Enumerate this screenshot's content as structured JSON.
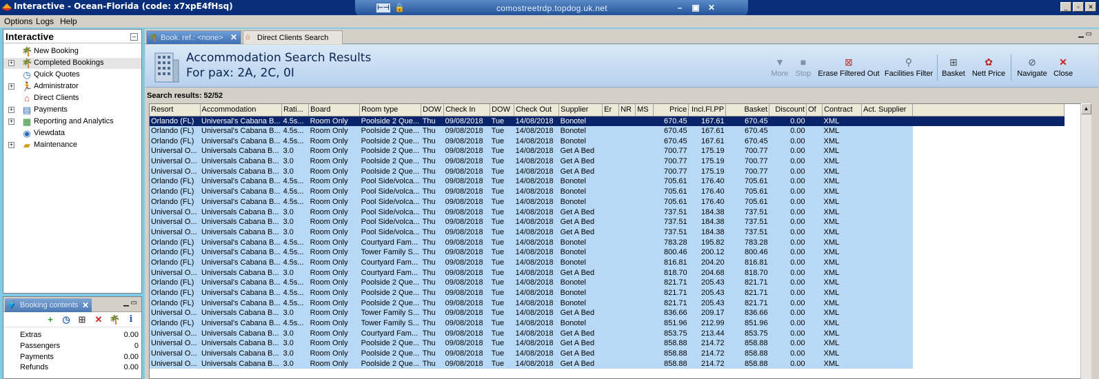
{
  "window": {
    "title": "Interactive - Ocean-Florida (code: x7xpE4fHsq)",
    "rdp_host": "comostreetrdp.topdog.uk.net"
  },
  "menu": [
    "Options",
    "Logs",
    "Help"
  ],
  "nav": {
    "title": "Interactive",
    "items": [
      {
        "label": "New Booking",
        "icon": "palm-tree-icon",
        "expandable": false
      },
      {
        "label": "Completed Bookings",
        "icon": "palm-tree-icon",
        "expandable": true
      },
      {
        "label": "Quick Quotes",
        "icon": "clock-icon",
        "expandable": false
      },
      {
        "label": "Administrator",
        "icon": "user-run-icon",
        "expandable": true
      },
      {
        "label": "Direct Clients",
        "icon": "house-icon",
        "expandable": false
      },
      {
        "label": "Payments",
        "icon": "payment-icon",
        "expandable": true
      },
      {
        "label": "Reporting and Analytics",
        "icon": "report-icon",
        "expandable": true
      },
      {
        "label": "Viewdata",
        "icon": "globe-icon",
        "expandable": false
      },
      {
        "label": "Maintenance",
        "icon": "folder-icon",
        "expandable": true
      }
    ]
  },
  "booking": {
    "tab_label": "Booking contents",
    "rows": [
      {
        "label": "Extras",
        "value": "0.00"
      },
      {
        "label": "Passengers",
        "value": "0"
      },
      {
        "label": "Payments",
        "value": "0.00"
      },
      {
        "label": "Refunds",
        "value": "0.00"
      }
    ]
  },
  "tabs": {
    "active": "Book. ref.: <none>",
    "second": "Direct Clients Search"
  },
  "header": {
    "title": "Accommodation Search Results",
    "subtitle": "For pax: 2A, 2C, 0I"
  },
  "toolbar": {
    "more": "More",
    "stop": "Stop",
    "erase": "Erase Filtered Out",
    "facilities": "Facilities Filter",
    "basket": "Basket",
    "nett": "Nett Price",
    "navigate": "Navigate",
    "close": "Close"
  },
  "results_label": "Search results: 52/52",
  "columns": [
    "Resort",
    "Accommodation",
    "Rati...",
    "Board",
    "Room type",
    "DOW",
    "Check In",
    "DOW",
    "Check Out",
    "Supplier",
    "Er",
    "NR",
    "MS",
    "Price",
    "Incl.Fl.PP",
    "Basket",
    "Discount",
    "Of",
    "Contract",
    "Act. Supplier"
  ],
  "rows": [
    [
      "Orlando (FL)",
      "Universal's Cabana B...",
      "4.5s...",
      "Room Only",
      "Poolside 2 Que...",
      "Thu",
      "09/08/2018",
      "Tue",
      "14/08/2018",
      "Bonotel",
      "",
      "",
      "",
      "670.45",
      "167.61",
      "670.45",
      "0.00",
      "",
      "XML",
      ""
    ],
    [
      "Orlando (FL)",
      "Universal's Cabana B...",
      "4.5s...",
      "Room Only",
      "Poolside 2 Que...",
      "Thu",
      "09/08/2018",
      "Tue",
      "14/08/2018",
      "Bonotel",
      "",
      "",
      "",
      "670.45",
      "167.61",
      "670.45",
      "0.00",
      "",
      "XML",
      ""
    ],
    [
      "Orlando (FL)",
      "Universal's Cabana B...",
      "4.5s...",
      "Room Only",
      "Poolside 2 Que...",
      "Thu",
      "09/08/2018",
      "Tue",
      "14/08/2018",
      "Bonotel",
      "",
      "",
      "",
      "670.45",
      "167.61",
      "670.45",
      "0.00",
      "",
      "XML",
      ""
    ],
    [
      "Universal O...",
      "Universals Cabana B...",
      "3.0",
      "Room Only",
      "Poolside 2 Que...",
      "Thu",
      "09/08/2018",
      "Tue",
      "14/08/2018",
      "Get A Bed",
      "",
      "",
      "",
      "700.77",
      "175.19",
      "700.77",
      "0.00",
      "",
      "XML",
      ""
    ],
    [
      "Universal O...",
      "Universals Cabana B...",
      "3.0",
      "Room Only",
      "Poolside 2 Que...",
      "Thu",
      "09/08/2018",
      "Tue",
      "14/08/2018",
      "Get A Bed",
      "",
      "",
      "",
      "700.77",
      "175.19",
      "700.77",
      "0.00",
      "",
      "XML",
      ""
    ],
    [
      "Universal O...",
      "Universals Cabana B...",
      "3.0",
      "Room Only",
      "Poolside 2 Que...",
      "Thu",
      "09/08/2018",
      "Tue",
      "14/08/2018",
      "Get A Bed",
      "",
      "",
      "",
      "700.77",
      "175.19",
      "700.77",
      "0.00",
      "",
      "XML",
      ""
    ],
    [
      "Orlando (FL)",
      "Universal's Cabana B...",
      "4.5s...",
      "Room Only",
      "Pool Side/volca...",
      "Thu",
      "09/08/2018",
      "Tue",
      "14/08/2018",
      "Bonotel",
      "",
      "",
      "",
      "705.61",
      "176.40",
      "705.61",
      "0.00",
      "",
      "XML",
      ""
    ],
    [
      "Orlando (FL)",
      "Universal's Cabana B...",
      "4.5s...",
      "Room Only",
      "Pool Side/volca...",
      "Thu",
      "09/08/2018",
      "Tue",
      "14/08/2018",
      "Bonotel",
      "",
      "",
      "",
      "705.61",
      "176.40",
      "705.61",
      "0.00",
      "",
      "XML",
      ""
    ],
    [
      "Orlando (FL)",
      "Universal's Cabana B...",
      "4.5s...",
      "Room Only",
      "Pool Side/volca...",
      "Thu",
      "09/08/2018",
      "Tue",
      "14/08/2018",
      "Bonotel",
      "",
      "",
      "",
      "705.61",
      "176.40",
      "705.61",
      "0.00",
      "",
      "XML",
      ""
    ],
    [
      "Universal O...",
      "Universals Cabana B...",
      "3.0",
      "Room Only",
      "Pool Side/volca...",
      "Thu",
      "09/08/2018",
      "Tue",
      "14/08/2018",
      "Get A Bed",
      "",
      "",
      "",
      "737.51",
      "184.38",
      "737.51",
      "0.00",
      "",
      "XML",
      ""
    ],
    [
      "Universal O...",
      "Universals Cabana B...",
      "3.0",
      "Room Only",
      "Pool Side/volca...",
      "Thu",
      "09/08/2018",
      "Tue",
      "14/08/2018",
      "Get A Bed",
      "",
      "",
      "",
      "737.51",
      "184.38",
      "737.51",
      "0.00",
      "",
      "XML",
      ""
    ],
    [
      "Universal O...",
      "Universals Cabana B...",
      "3.0",
      "Room Only",
      "Pool Side/volca...",
      "Thu",
      "09/08/2018",
      "Tue",
      "14/08/2018",
      "Get A Bed",
      "",
      "",
      "",
      "737.51",
      "184.38",
      "737.51",
      "0.00",
      "",
      "XML",
      ""
    ],
    [
      "Orlando (FL)",
      "Universal's Cabana B...",
      "4.5s...",
      "Room Only",
      "Courtyard Fam...",
      "Thu",
      "09/08/2018",
      "Tue",
      "14/08/2018",
      "Bonotel",
      "",
      "",
      "",
      "783.28",
      "195.82",
      "783.28",
      "0.00",
      "",
      "XML",
      ""
    ],
    [
      "Orlando (FL)",
      "Universal's Cabana B...",
      "4.5s...",
      "Room Only",
      "Tower Family S...",
      "Thu",
      "09/08/2018",
      "Tue",
      "14/08/2018",
      "Bonotel",
      "",
      "",
      "",
      "800.46",
      "200.12",
      "800.46",
      "0.00",
      "",
      "XML",
      ""
    ],
    [
      "Orlando (FL)",
      "Universal's Cabana B...",
      "4.5s...",
      "Room Only",
      "Courtyard Fam...",
      "Thu",
      "09/08/2018",
      "Tue",
      "14/08/2018",
      "Bonotel",
      "",
      "",
      "",
      "816.81",
      "204.20",
      "816.81",
      "0.00",
      "",
      "XML",
      ""
    ],
    [
      "Universal O...",
      "Universals Cabana B...",
      "3.0",
      "Room Only",
      "Courtyard Fam...",
      "Thu",
      "09/08/2018",
      "Tue",
      "14/08/2018",
      "Get A Bed",
      "",
      "",
      "",
      "818.70",
      "204.68",
      "818.70",
      "0.00",
      "",
      "XML",
      ""
    ],
    [
      "Orlando (FL)",
      "Universal's Cabana B...",
      "4.5s...",
      "Room Only",
      "Poolside 2 Que...",
      "Thu",
      "09/08/2018",
      "Tue",
      "14/08/2018",
      "Bonotel",
      "",
      "",
      "",
      "821.71",
      "205.43",
      "821.71",
      "0.00",
      "",
      "XML",
      ""
    ],
    [
      "Orlando (FL)",
      "Universal's Cabana B...",
      "4.5s...",
      "Room Only",
      "Poolside 2 Que...",
      "Thu",
      "09/08/2018",
      "Tue",
      "14/08/2018",
      "Bonotel",
      "",
      "",
      "",
      "821.71",
      "205.43",
      "821.71",
      "0.00",
      "",
      "XML",
      ""
    ],
    [
      "Orlando (FL)",
      "Universal's Cabana B...",
      "4.5s...",
      "Room Only",
      "Poolside 2 Que...",
      "Thu",
      "09/08/2018",
      "Tue",
      "14/08/2018",
      "Bonotel",
      "",
      "",
      "",
      "821.71",
      "205.43",
      "821.71",
      "0.00",
      "",
      "XML",
      ""
    ],
    [
      "Universal O...",
      "Universals Cabana B...",
      "3.0",
      "Room Only",
      "Tower Family S...",
      "Thu",
      "09/08/2018",
      "Tue",
      "14/08/2018",
      "Get A Bed",
      "",
      "",
      "",
      "836.66",
      "209.17",
      "836.66",
      "0.00",
      "",
      "XML",
      ""
    ],
    [
      "Orlando (FL)",
      "Universal's Cabana B...",
      "4.5s...",
      "Room Only",
      "Tower Family S...",
      "Thu",
      "09/08/2018",
      "Tue",
      "14/08/2018",
      "Bonotel",
      "",
      "",
      "",
      "851.96",
      "212.99",
      "851.96",
      "0.00",
      "",
      "XML",
      ""
    ],
    [
      "Universal O...",
      "Universals Cabana B...",
      "3.0",
      "Room Only",
      "Courtyard Fam...",
      "Thu",
      "09/08/2018",
      "Tue",
      "14/08/2018",
      "Get A Bed",
      "",
      "",
      "",
      "853.75",
      "213.44",
      "853.75",
      "0.00",
      "",
      "XML",
      ""
    ],
    [
      "Universal O...",
      "Universals Cabana B...",
      "3.0",
      "Room Only",
      "Poolside 2 Que...",
      "Thu",
      "09/08/2018",
      "Tue",
      "14/08/2018",
      "Get A Bed",
      "",
      "",
      "",
      "858.88",
      "214.72",
      "858.88",
      "0.00",
      "",
      "XML",
      ""
    ],
    [
      "Universal O...",
      "Universals Cabana B...",
      "3.0",
      "Room Only",
      "Poolside 2 Que...",
      "Thu",
      "09/08/2018",
      "Tue",
      "14/08/2018",
      "Get A Bed",
      "",
      "",
      "",
      "858.88",
      "214.72",
      "858.88",
      "0.00",
      "",
      "XML",
      ""
    ],
    [
      "Universal O...",
      "Universals Cabana B...",
      "3.0",
      "Room Only",
      "Poolside 2 Que...",
      "Thu",
      "09/08/2018",
      "Tue",
      "14/08/2018",
      "Get A Bed",
      "",
      "",
      "",
      "858.88",
      "214.72",
      "858.88",
      "0.00",
      "",
      "XML",
      ""
    ]
  ],
  "colors": {
    "title_bar": "#0a2f7a",
    "selected_row": "#0a246a",
    "row_bg": "#b8d9f5",
    "header_band": "#c8dcf2"
  }
}
